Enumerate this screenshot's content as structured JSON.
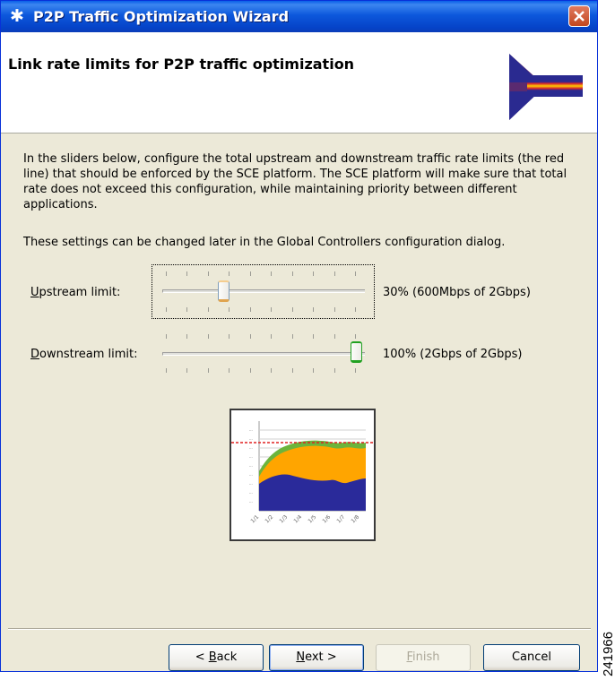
{
  "window": {
    "title": "P2P Traffic Optimization Wizard",
    "title_icon": "✱"
  },
  "header": {
    "title": "Link rate limits for P2P traffic optimization"
  },
  "content": {
    "description": "In the sliders below, configure the total upstream and downstream traffic rate limits (the red line) that should be enforced by the SCE platform. The SCE platform will make sure that total rate does not exceed this configuration, while maintaining priority between different applications.",
    "note": "These settings can be changed later in the Global Controllers configuration dialog."
  },
  "sliders": {
    "upstream": {
      "label_mnemonic": "U",
      "label_rest": "pstream limit:",
      "value_text": "30% (600Mbps of 2Gbps)",
      "value_percent": 30
    },
    "downstream": {
      "label_mnemonic": "D",
      "label_rest": "ownstream limit:",
      "value_text": "100% (2Gbps of 2Gbps)",
      "value_percent": 100
    }
  },
  "buttons": {
    "back_prefix": "< ",
    "back_mnemonic": "B",
    "back_rest": "ack",
    "next_mnemonic": "N",
    "next_rest": "ext >",
    "finish_mnemonic": "F",
    "finish_rest": "inish",
    "cancel": "Cancel"
  },
  "side_label": "241966",
  "colors": {
    "accent": "#0a58dc",
    "chart_dark": "#2a2a9a",
    "chart_orange": "#ffa500",
    "chart_green": "#66b032",
    "limit_line": "#e02020"
  }
}
